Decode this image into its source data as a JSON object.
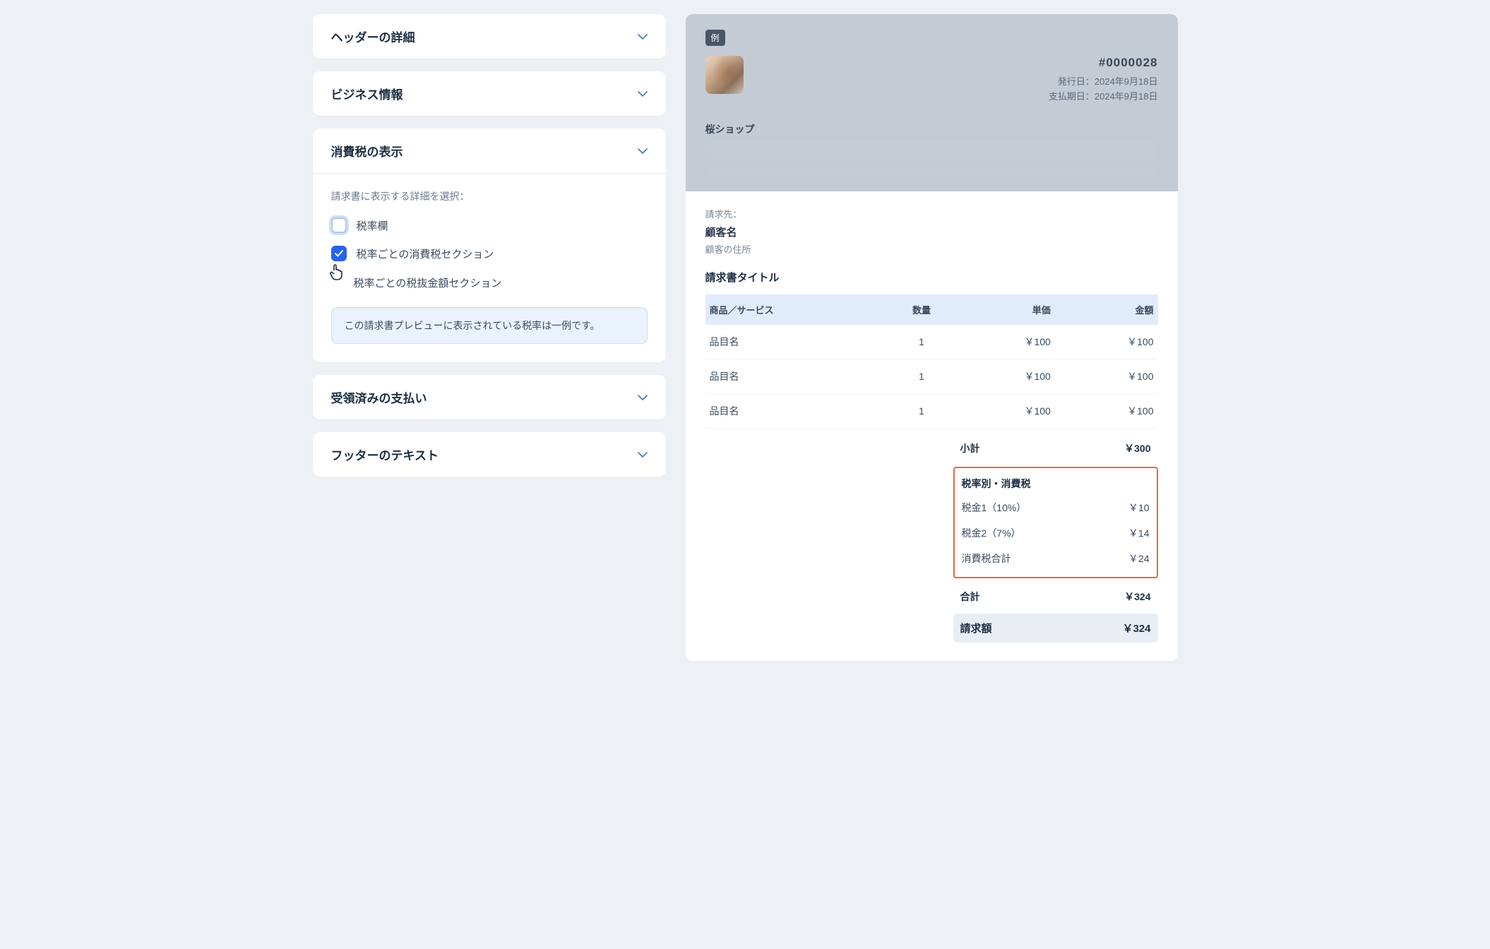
{
  "sections": {
    "header_details": "ヘッダーの詳細",
    "business_info": "ビジネス情報",
    "tax_display": "消費税の表示",
    "payments_received": "受領済みの支払い",
    "footer_text": "フッターのテキスト"
  },
  "tax_panel": {
    "description": "請求書に表示する詳細を選択：",
    "opt_rate_column": "税率欄",
    "opt_tax_per_rate": "税率ごとの消費税セクション",
    "opt_pretax_per_rate": "税率ごとの税抜金額セクション",
    "info_note": "この請求書プレビューに表示されている税率は一例です。"
  },
  "preview": {
    "example_badge": "例",
    "invoice_number": "#0000028",
    "issue_date": "発行日：2024年9月18日",
    "due_date": "支払期日：2024年9月18日",
    "shop_name": "桜ショップ",
    "bill_to_label": "請求先：",
    "customer_name": "顧客名",
    "customer_address": "顧客の住所",
    "invoice_title": "請求書タイトル",
    "columns": {
      "item": "商品／サービス",
      "qty": "数量",
      "unit": "単価",
      "amount": "金額"
    },
    "items": [
      {
        "name": "品目名",
        "qty": "1",
        "unit": "￥100",
        "amount": "￥100"
      },
      {
        "name": "品目名",
        "qty": "1",
        "unit": "￥100",
        "amount": "￥100"
      },
      {
        "name": "品目名",
        "qty": "1",
        "unit": "￥100",
        "amount": "￥100"
      }
    ],
    "subtotal_label": "小計",
    "subtotal_value": "￥300",
    "tax_section_title": "税率別・消費税",
    "tax_lines": [
      {
        "label": "税金1（10%）",
        "value": "￥10"
      },
      {
        "label": "税金2（7%）",
        "value": "￥14"
      },
      {
        "label": "消費税合計",
        "value": "￥24"
      }
    ],
    "total_label": "合計",
    "total_value": "￥324",
    "grand_label": "請求額",
    "grand_value": "￥324"
  }
}
